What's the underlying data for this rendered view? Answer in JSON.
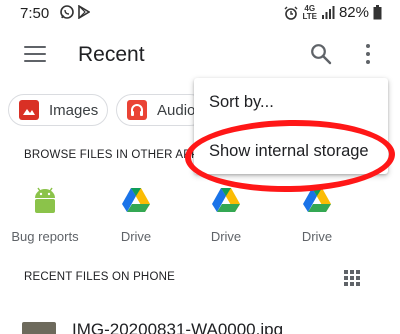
{
  "status_bar": {
    "time": "7:50",
    "network": "4G",
    "network_sub": "LTE",
    "battery": "82%"
  },
  "app_bar": {
    "title": "Recent"
  },
  "chips": [
    {
      "label": "Images",
      "icon": "image-icon"
    },
    {
      "label": "Audio",
      "icon": "headphones-icon"
    }
  ],
  "browse": {
    "header": "BROWSE FILES IN OTHER APPS",
    "apps": [
      {
        "label": "Bug reports",
        "icon": "android-icon"
      },
      {
        "label": "Drive",
        "icon": "google-drive-icon"
      },
      {
        "label": "Drive",
        "icon": "google-drive-icon"
      },
      {
        "label": "Drive",
        "icon": "google-drive-icon"
      }
    ]
  },
  "recent": {
    "header": "RECENT FILES ON PHONE",
    "files": [
      {
        "name": "IMG-20200831-WA0000.jpg"
      }
    ]
  },
  "popup_menu": {
    "items": [
      {
        "label": "Sort by..."
      },
      {
        "label": "Show internal storage"
      }
    ]
  },
  "colors": {
    "annotation": "#ff1717",
    "images_chip": "#d93025",
    "audio_chip": "#ea4335"
  }
}
